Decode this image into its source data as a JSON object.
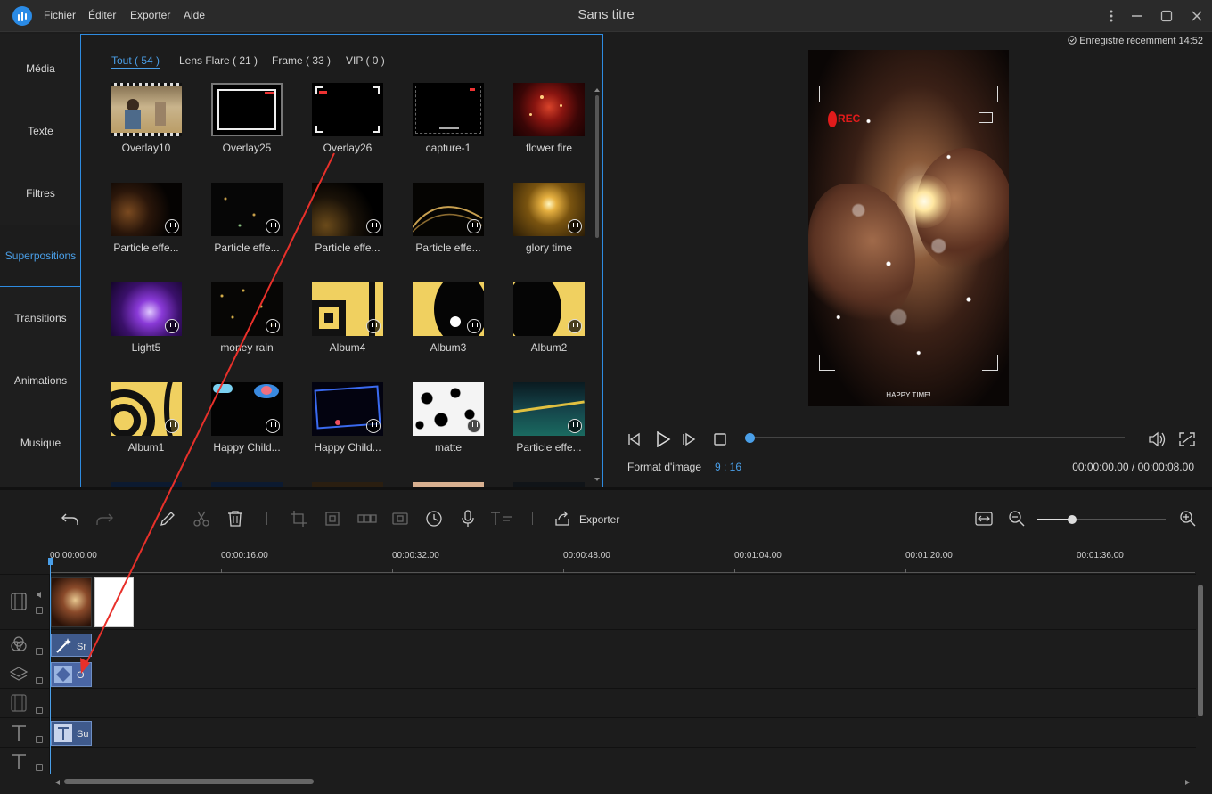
{
  "app": {
    "title": "Sans titre",
    "menu": [
      "Fichier",
      "Éditer",
      "Exporter",
      "Aide"
    ],
    "accent_color": "#2e8be0"
  },
  "sidebar": {
    "items": [
      {
        "label": "Média",
        "active": false
      },
      {
        "label": "Texte",
        "active": false
      },
      {
        "label": "Filtres",
        "active": false
      },
      {
        "label": "Superpositions",
        "active": true
      },
      {
        "label": "Transitions",
        "active": false
      },
      {
        "label": "Animations",
        "active": false
      },
      {
        "label": "Musique",
        "active": false
      }
    ]
  },
  "library": {
    "tabs": [
      {
        "label": "Tout ( 54 )",
        "active": true
      },
      {
        "label": "Lens Flare ( 21 )",
        "active": false
      },
      {
        "label": "Frame ( 33 )",
        "active": false
      },
      {
        "label": "VIP ( 0 )",
        "active": false
      }
    ],
    "items": [
      {
        "name": "Overlay10",
        "download": false
      },
      {
        "name": "Overlay25",
        "download": false
      },
      {
        "name": "Overlay26",
        "download": false
      },
      {
        "name": "capture-1",
        "download": false
      },
      {
        "name": "flower fire",
        "download": false
      },
      {
        "name": "Particle effe...",
        "download": true
      },
      {
        "name": "Particle effe...",
        "download": true
      },
      {
        "name": "Particle effe...",
        "download": true
      },
      {
        "name": "Particle effe...",
        "download": true
      },
      {
        "name": "glory time",
        "download": true
      },
      {
        "name": "Light5",
        "download": true
      },
      {
        "name": "money rain",
        "download": true
      },
      {
        "name": "Album4",
        "download": true
      },
      {
        "name": "Album3",
        "download": true
      },
      {
        "name": "Album2",
        "download": true
      },
      {
        "name": "Album1",
        "download": true
      },
      {
        "name": "Happy Child...",
        "download": true
      },
      {
        "name": "Happy Child...",
        "download": true
      },
      {
        "name": "matte",
        "download": true
      },
      {
        "name": "Particle effe...",
        "download": true
      }
    ]
  },
  "preview": {
    "saved_status": "Enregistré récemment 14:52",
    "video_caption": "HAPPY TIME!",
    "rec_text": "REC",
    "format_label": "Format d'image",
    "format_value": "9 : 16",
    "time_readout": "00:00:00.00 / 00:00:08.00",
    "progress": 0
  },
  "toolbar": {
    "export_label": "Exporter",
    "zoom_level": 0.25
  },
  "timeline": {
    "ticks": [
      "00:00:00.00",
      "00:00:16.00",
      "00:00:32.00",
      "00:00:48.00",
      "00:01:04.00",
      "00:01:20.00",
      "00:01:36.00"
    ],
    "clips": {
      "filter": "Sr",
      "overlay": "O",
      "text": "Su"
    }
  }
}
